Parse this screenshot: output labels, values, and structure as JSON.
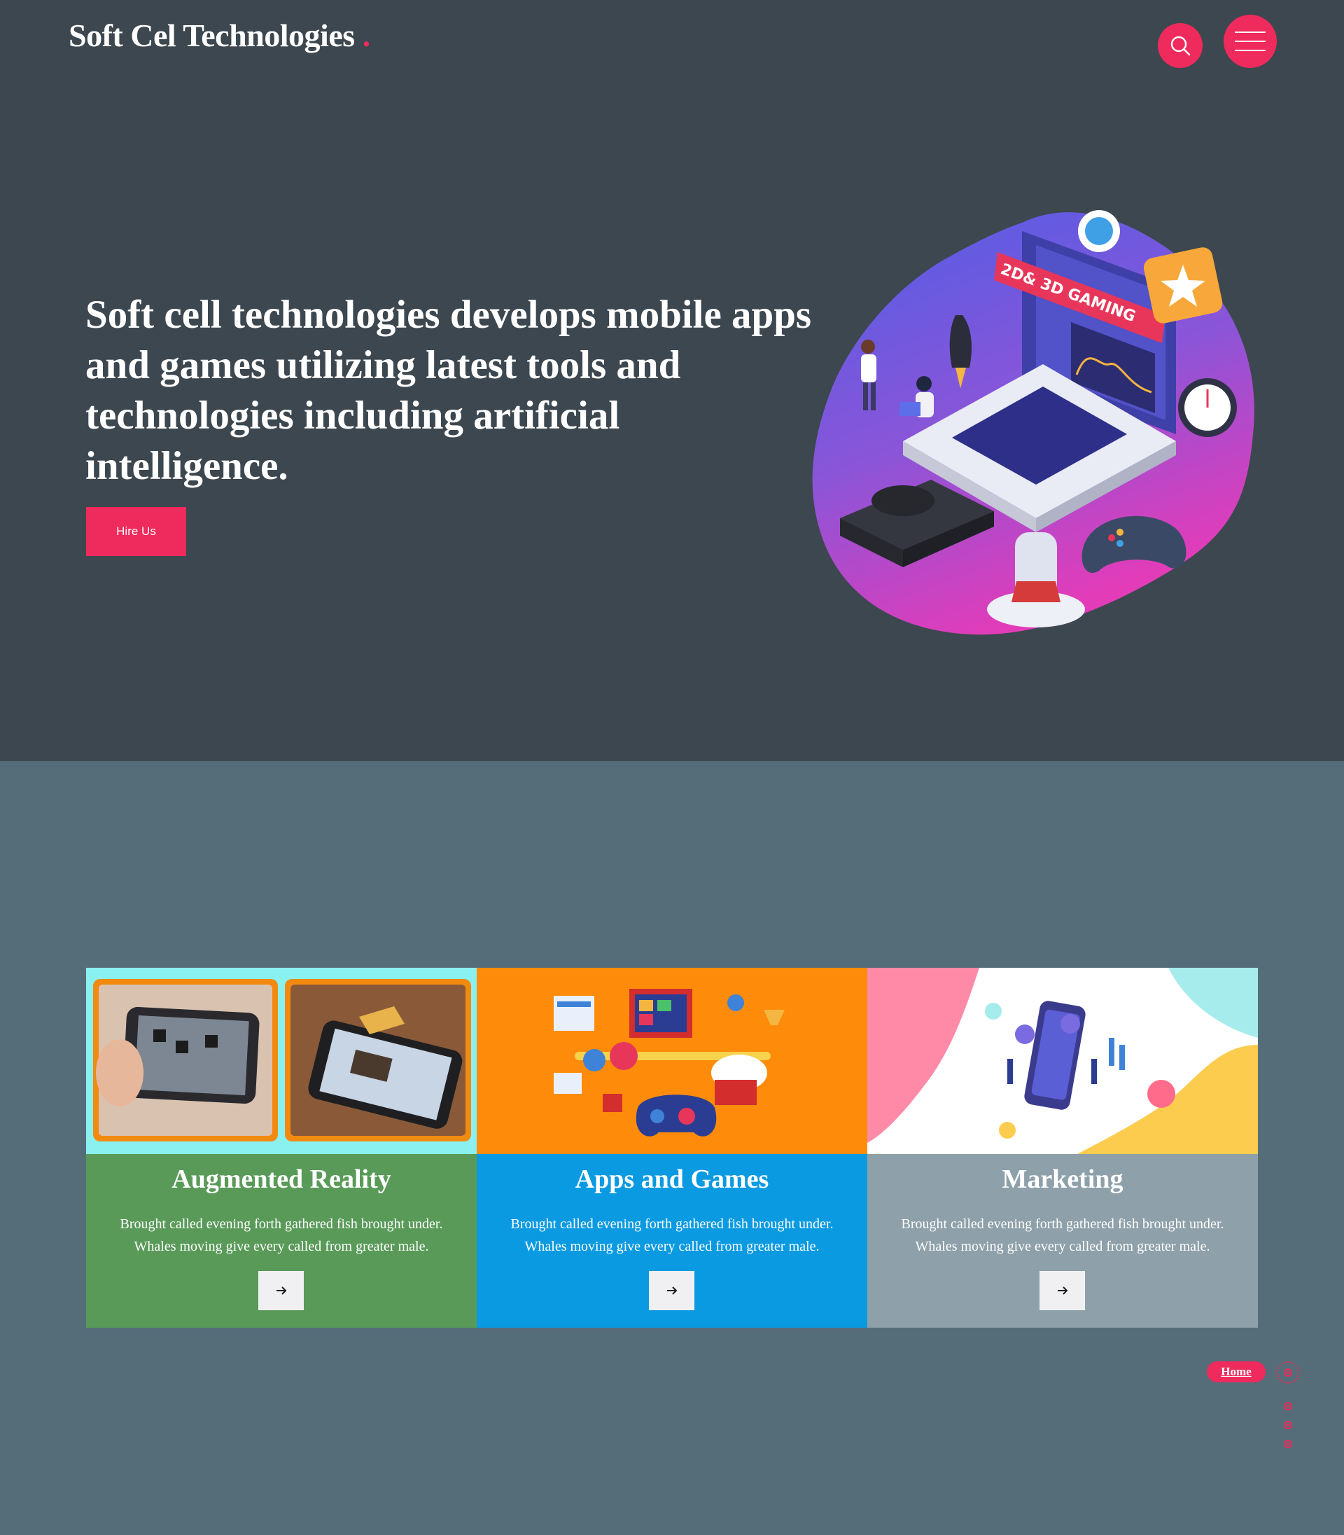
{
  "header": {
    "logo_text": "Soft Cel Technologies",
    "logo_dot": ".",
    "search_icon": "search-icon",
    "menu_icon": "hamburger-menu-icon"
  },
  "hero": {
    "title": "Soft cell technologies develops mobile apps and games utilizing latest tools and technologies including artificial intelligence.",
    "cta_label": "Hire Us",
    "illustration_label": "2D& 3D GAMING"
  },
  "services": [
    {
      "title": "Augmented Reality",
      "text": "Brought called evening forth gathered fish brought under. Whales moving give every called from greater male.",
      "color": "#599a59",
      "icon": "arrow-right-icon"
    },
    {
      "title": "Apps and Games",
      "text": "Brought called evening forth gathered fish brought under. Whales moving give every called from greater male.",
      "color": "#0a9ae2",
      "icon": "arrow-right-icon"
    },
    {
      "title": "Marketing",
      "text": "Brought called evening forth gathered fish brought under. Whales moving give every called from greater male.",
      "color": "#8ea0a9",
      "icon": "arrow-right-icon"
    }
  ],
  "side_nav": {
    "active_label": "Home"
  },
  "colors": {
    "accent": "#ee2b5c",
    "hero_bg": "#3d474f",
    "section_bg": "#556d79"
  }
}
